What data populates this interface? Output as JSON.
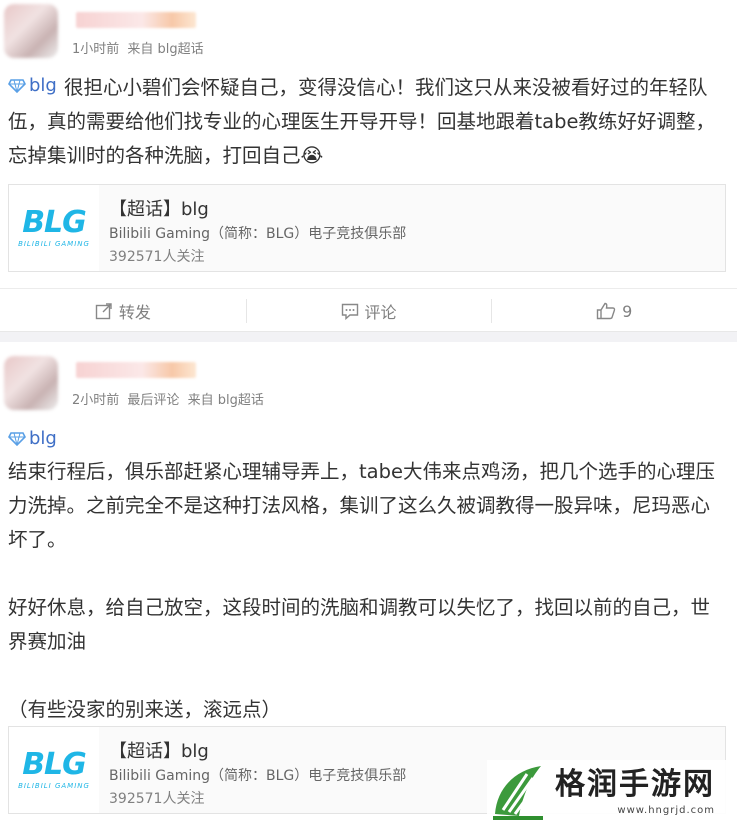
{
  "posts": [
    {
      "meta": {
        "time": "1小时前",
        "source": "来自 blg超话"
      },
      "tag": "blg",
      "paragraphs": [
        "很担心小碧们会怀疑自己，变得没信心！我们这只从来没被看好过的年轻队伍，真的需要给他们找专业的心理医生开导开导！回基地跟着tabe教练好好调整，忘掉集训时的各种洗脑，打回自己😭"
      ],
      "card": {
        "logo_text": "BLG",
        "logo_sub": "BILIBILI GAMING",
        "title": "【超话】blg",
        "desc": "Bilibili Gaming（简称：BLG）电子竞技俱乐部",
        "followers": "392571人关注"
      },
      "actions": {
        "repost": "转发",
        "comment": "评论",
        "like": "9"
      }
    },
    {
      "meta": {
        "time": "2小时前",
        "last_comment": "最后评论",
        "source": "来自 blg超话"
      },
      "tag": "blg",
      "paragraphs": [
        "结束行程后，俱乐部赶紧心理辅导弄上，tabe大伟来点鸡汤，把几个选手的心理压力洗掉。之前完全不是这种打法风格，集训了这么久被调教得一股异味，尼玛恶心坏了。",
        "好好休息，给自己放空，这段时间的洗脑和调教可以失忆了，找回以前的自己，世界赛加油",
        "（有些没家的别来送，滚远点）"
      ],
      "card": {
        "logo_text": "BLG",
        "logo_sub": "BILIBILI GAMING",
        "title": "【超话】blg",
        "desc": "Bilibili Gaming（简称：BLG）电子竞技俱乐部",
        "followers": "392571人关注"
      }
    }
  ],
  "watermark": {
    "title": "格润手游网",
    "url": "www.hngrjd.com"
  },
  "colors": {
    "link": "#3f6fc6",
    "brand": "#1fb6e6",
    "watermark_green": "#2f8f2f"
  }
}
